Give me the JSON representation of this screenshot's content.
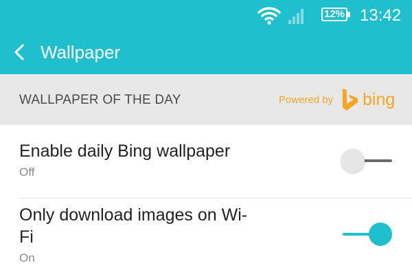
{
  "status_bar": {
    "wifi_icon": "wifi-icon",
    "signal_icon": "cell-signal-icon",
    "battery_percent": "12%",
    "time": "13:42"
  },
  "app_bar": {
    "back_icon": "chevron-left-icon",
    "title": "Wallpaper"
  },
  "section": {
    "title": "WALLPAPER OF THE DAY",
    "powered_by": "Powered by",
    "brand_logo": "bing-logo",
    "brand_name": "bing"
  },
  "settings": [
    {
      "title": "Enable daily Bing wallpaper",
      "status": "Off",
      "enabled": false
    },
    {
      "title": "Only download images on Wi-Fi",
      "status": "On",
      "enabled": true
    }
  ],
  "colors": {
    "accent": "#1fbfcd",
    "bing_orange": "#f5a623",
    "section_bg": "#e8e8e8"
  }
}
